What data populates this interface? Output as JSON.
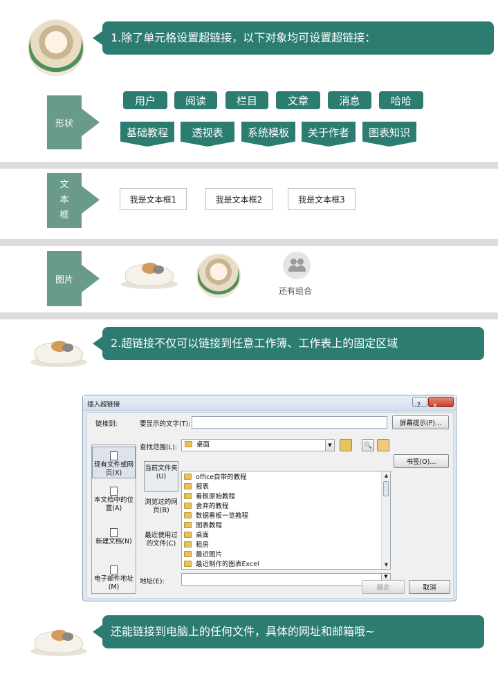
{
  "bubbles": {
    "b1": "1.除了单元格设置超链接，以下对象均可设置超链接：",
    "b2": "2.超链接不仅可以链接到任意工作簿、工作表上的固定区域",
    "b3": "还能链接到电脑上的任何文件，具体的网址和邮箱哦~"
  },
  "tags": {
    "shape": "形状",
    "textbox": [
      "文",
      "本",
      "框"
    ],
    "image": "图片"
  },
  "shapes_row1": [
    "用户",
    "阅读",
    "栏目",
    "文章",
    "消息",
    "哈哈"
  ],
  "shapes_row2": [
    "基础教程",
    "透视表",
    "系统模板",
    "关于作者",
    "图表知识"
  ],
  "textboxes": [
    "我是文本框1",
    "我是文本框2",
    "我是文本框3"
  ],
  "image_section": {
    "group_label": "还有组合"
  },
  "dialog": {
    "title": "插入超链接",
    "help_btn": "?",
    "close_btn": "x",
    "link_to_label": "链接到:",
    "display_text_label": "要显示的文字(T):",
    "display_text_value": "",
    "screentip_btn": "屏幕提示(P)...",
    "lookin_label": "查找范围(L):",
    "lookin_value": "桌面",
    "bookmark_btn": "书签(O)...",
    "sidebar": [
      "现有文件或网页(X)",
      "本文档中的位置(A)",
      "新建文档(N)",
      "电子邮件地址(M)"
    ],
    "nav": [
      "当前文件夹(U)",
      "浏览过的网页(B)",
      "最近使用过的文件(C)"
    ],
    "files": [
      "office自带的教程",
      "报表",
      "看板原始教程",
      "舍弃的教程",
      "数据看板一览教程",
      "图表教程",
      "桌面",
      "租房",
      "最近图片",
      "最近制作的图表Excel"
    ],
    "address_label": "地址(E):",
    "address_value": "",
    "ok_btn": "确定",
    "cancel_btn": "取消"
  },
  "colors": {
    "teal": "#2c7c72",
    "tag_green": "#6a9a8a",
    "separator": "#dcdcdc"
  }
}
